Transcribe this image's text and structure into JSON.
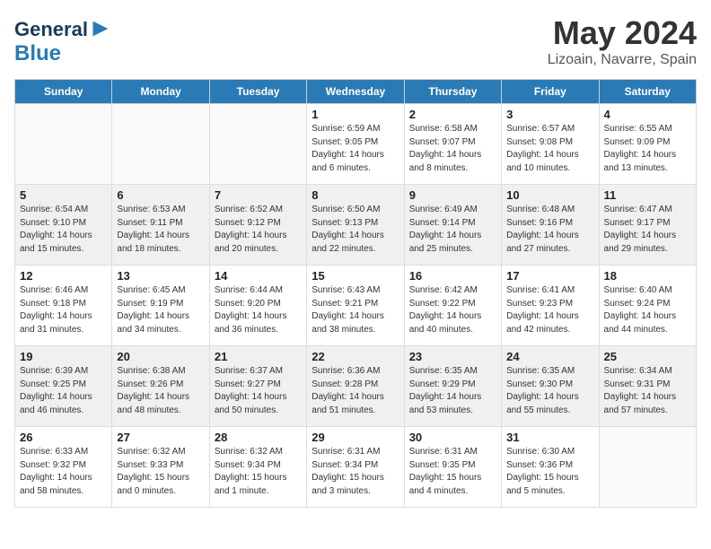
{
  "header": {
    "logo_line1": "General",
    "logo_line2": "Blue",
    "month": "May 2024",
    "location": "Lizoain, Navarre, Spain"
  },
  "days_of_week": [
    "Sunday",
    "Monday",
    "Tuesday",
    "Wednesday",
    "Thursday",
    "Friday",
    "Saturday"
  ],
  "weeks": [
    [
      {
        "day": "",
        "info": ""
      },
      {
        "day": "",
        "info": ""
      },
      {
        "day": "",
        "info": ""
      },
      {
        "day": "1",
        "info": "Sunrise: 6:59 AM\nSunset: 9:05 PM\nDaylight: 14 hours\nand 6 minutes."
      },
      {
        "day": "2",
        "info": "Sunrise: 6:58 AM\nSunset: 9:07 PM\nDaylight: 14 hours\nand 8 minutes."
      },
      {
        "day": "3",
        "info": "Sunrise: 6:57 AM\nSunset: 9:08 PM\nDaylight: 14 hours\nand 10 minutes."
      },
      {
        "day": "4",
        "info": "Sunrise: 6:55 AM\nSunset: 9:09 PM\nDaylight: 14 hours\nand 13 minutes."
      }
    ],
    [
      {
        "day": "5",
        "info": "Sunrise: 6:54 AM\nSunset: 9:10 PM\nDaylight: 14 hours\nand 15 minutes."
      },
      {
        "day": "6",
        "info": "Sunrise: 6:53 AM\nSunset: 9:11 PM\nDaylight: 14 hours\nand 18 minutes."
      },
      {
        "day": "7",
        "info": "Sunrise: 6:52 AM\nSunset: 9:12 PM\nDaylight: 14 hours\nand 20 minutes."
      },
      {
        "day": "8",
        "info": "Sunrise: 6:50 AM\nSunset: 9:13 PM\nDaylight: 14 hours\nand 22 minutes."
      },
      {
        "day": "9",
        "info": "Sunrise: 6:49 AM\nSunset: 9:14 PM\nDaylight: 14 hours\nand 25 minutes."
      },
      {
        "day": "10",
        "info": "Sunrise: 6:48 AM\nSunset: 9:16 PM\nDaylight: 14 hours\nand 27 minutes."
      },
      {
        "day": "11",
        "info": "Sunrise: 6:47 AM\nSunset: 9:17 PM\nDaylight: 14 hours\nand 29 minutes."
      }
    ],
    [
      {
        "day": "12",
        "info": "Sunrise: 6:46 AM\nSunset: 9:18 PM\nDaylight: 14 hours\nand 31 minutes."
      },
      {
        "day": "13",
        "info": "Sunrise: 6:45 AM\nSunset: 9:19 PM\nDaylight: 14 hours\nand 34 minutes."
      },
      {
        "day": "14",
        "info": "Sunrise: 6:44 AM\nSunset: 9:20 PM\nDaylight: 14 hours\nand 36 minutes."
      },
      {
        "day": "15",
        "info": "Sunrise: 6:43 AM\nSunset: 9:21 PM\nDaylight: 14 hours\nand 38 minutes."
      },
      {
        "day": "16",
        "info": "Sunrise: 6:42 AM\nSunset: 9:22 PM\nDaylight: 14 hours\nand 40 minutes."
      },
      {
        "day": "17",
        "info": "Sunrise: 6:41 AM\nSunset: 9:23 PM\nDaylight: 14 hours\nand 42 minutes."
      },
      {
        "day": "18",
        "info": "Sunrise: 6:40 AM\nSunset: 9:24 PM\nDaylight: 14 hours\nand 44 minutes."
      }
    ],
    [
      {
        "day": "19",
        "info": "Sunrise: 6:39 AM\nSunset: 9:25 PM\nDaylight: 14 hours\nand 46 minutes."
      },
      {
        "day": "20",
        "info": "Sunrise: 6:38 AM\nSunset: 9:26 PM\nDaylight: 14 hours\nand 48 minutes."
      },
      {
        "day": "21",
        "info": "Sunrise: 6:37 AM\nSunset: 9:27 PM\nDaylight: 14 hours\nand 50 minutes."
      },
      {
        "day": "22",
        "info": "Sunrise: 6:36 AM\nSunset: 9:28 PM\nDaylight: 14 hours\nand 51 minutes."
      },
      {
        "day": "23",
        "info": "Sunrise: 6:35 AM\nSunset: 9:29 PM\nDaylight: 14 hours\nand 53 minutes."
      },
      {
        "day": "24",
        "info": "Sunrise: 6:35 AM\nSunset: 9:30 PM\nDaylight: 14 hours\nand 55 minutes."
      },
      {
        "day": "25",
        "info": "Sunrise: 6:34 AM\nSunset: 9:31 PM\nDaylight: 14 hours\nand 57 minutes."
      }
    ],
    [
      {
        "day": "26",
        "info": "Sunrise: 6:33 AM\nSunset: 9:32 PM\nDaylight: 14 hours\nand 58 minutes."
      },
      {
        "day": "27",
        "info": "Sunrise: 6:32 AM\nSunset: 9:33 PM\nDaylight: 15 hours\nand 0 minutes."
      },
      {
        "day": "28",
        "info": "Sunrise: 6:32 AM\nSunset: 9:34 PM\nDaylight: 15 hours\nand 1 minute."
      },
      {
        "day": "29",
        "info": "Sunrise: 6:31 AM\nSunset: 9:34 PM\nDaylight: 15 hours\nand 3 minutes."
      },
      {
        "day": "30",
        "info": "Sunrise: 6:31 AM\nSunset: 9:35 PM\nDaylight: 15 hours\nand 4 minutes."
      },
      {
        "day": "31",
        "info": "Sunrise: 6:30 AM\nSunset: 9:36 PM\nDaylight: 15 hours\nand 5 minutes."
      },
      {
        "day": "",
        "info": ""
      }
    ]
  ]
}
